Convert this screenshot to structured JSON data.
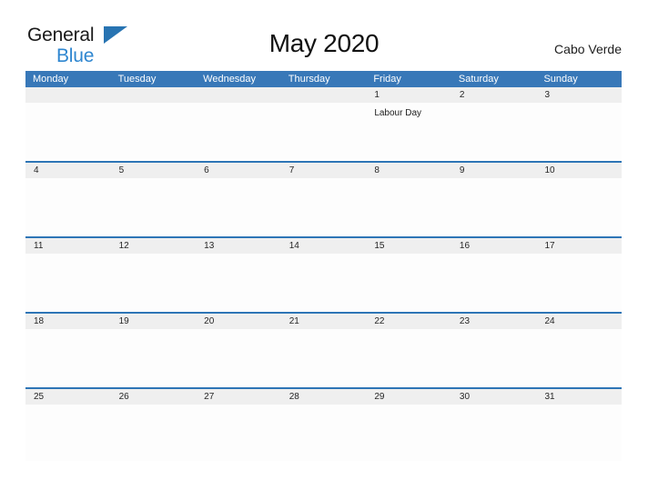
{
  "brand": {
    "name_part_1": "General",
    "name_part_2": "Blue",
    "logo_icon": "triangle-sail-icon",
    "color_dark": "#1a1a1a",
    "color_blue": "#2E86D0",
    "triangle_color": "#2874B2"
  },
  "header": {
    "title": "May 2020",
    "region": "Cabo Verde"
  },
  "theme": {
    "header_blue": "#3878B8",
    "row_border_blue": "#2E75B6",
    "date_band_gray": "#EFEFEF",
    "page_background": "#FFFFFF"
  },
  "weekdays": [
    {
      "label": "Monday"
    },
    {
      "label": "Tuesday"
    },
    {
      "label": "Wednesday"
    },
    {
      "label": "Thursday"
    },
    {
      "label": "Friday"
    },
    {
      "label": "Saturday"
    },
    {
      "label": "Sunday"
    }
  ],
  "weeks": [
    {
      "days": [
        {
          "date": "",
          "events": []
        },
        {
          "date": "",
          "events": []
        },
        {
          "date": "",
          "events": []
        },
        {
          "date": "",
          "events": []
        },
        {
          "date": "1",
          "events": [
            {
              "name": "Labour Day"
            }
          ]
        },
        {
          "date": "2",
          "events": []
        },
        {
          "date": "3",
          "events": []
        }
      ]
    },
    {
      "days": [
        {
          "date": "4",
          "events": []
        },
        {
          "date": "5",
          "events": []
        },
        {
          "date": "6",
          "events": []
        },
        {
          "date": "7",
          "events": []
        },
        {
          "date": "8",
          "events": []
        },
        {
          "date": "9",
          "events": []
        },
        {
          "date": "10",
          "events": []
        }
      ]
    },
    {
      "days": [
        {
          "date": "11",
          "events": []
        },
        {
          "date": "12",
          "events": []
        },
        {
          "date": "13",
          "events": []
        },
        {
          "date": "14",
          "events": []
        },
        {
          "date": "15",
          "events": []
        },
        {
          "date": "16",
          "events": []
        },
        {
          "date": "17",
          "events": []
        }
      ]
    },
    {
      "days": [
        {
          "date": "18",
          "events": []
        },
        {
          "date": "19",
          "events": []
        },
        {
          "date": "20",
          "events": []
        },
        {
          "date": "21",
          "events": []
        },
        {
          "date": "22",
          "events": []
        },
        {
          "date": "23",
          "events": []
        },
        {
          "date": "24",
          "events": []
        }
      ]
    },
    {
      "days": [
        {
          "date": "25",
          "events": []
        },
        {
          "date": "26",
          "events": []
        },
        {
          "date": "27",
          "events": []
        },
        {
          "date": "28",
          "events": []
        },
        {
          "date": "29",
          "events": []
        },
        {
          "date": "30",
          "events": []
        },
        {
          "date": "31",
          "events": []
        }
      ]
    }
  ]
}
